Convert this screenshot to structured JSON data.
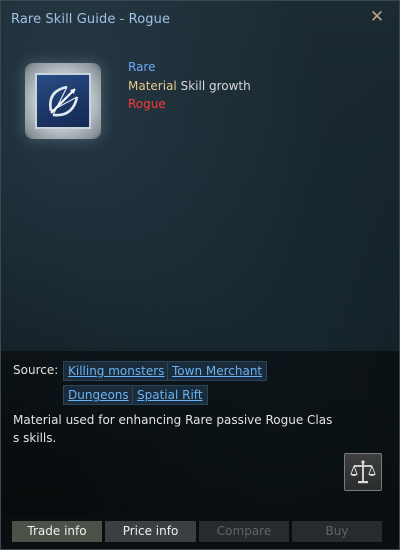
{
  "window": {
    "title": "Rare Skill Guide - Rogue",
    "close_glyph": "✕"
  },
  "item": {
    "icon": "bow-icon",
    "grade": "Rare",
    "material_label": "Material",
    "material_value": "Skill growth",
    "class": "Rogue"
  },
  "source": {
    "label": "Source:",
    "links": [
      "Killing monsters",
      "Town Merchant",
      "Dungeons",
      "Spatial Rift"
    ]
  },
  "description": "Material used for enhancing Rare passive Rogue Class skills.",
  "actions": {
    "scale_icon": "scale-icon"
  },
  "footer": {
    "buttons": [
      "Trade info",
      "Price info",
      "Compare",
      "Buy"
    ]
  },
  "colors": {
    "grade": "#6fa8ff",
    "material_key": "#e6c98a",
    "class": "#ff3636",
    "link": "#6bb2f2",
    "title": "#9ec3e6"
  }
}
